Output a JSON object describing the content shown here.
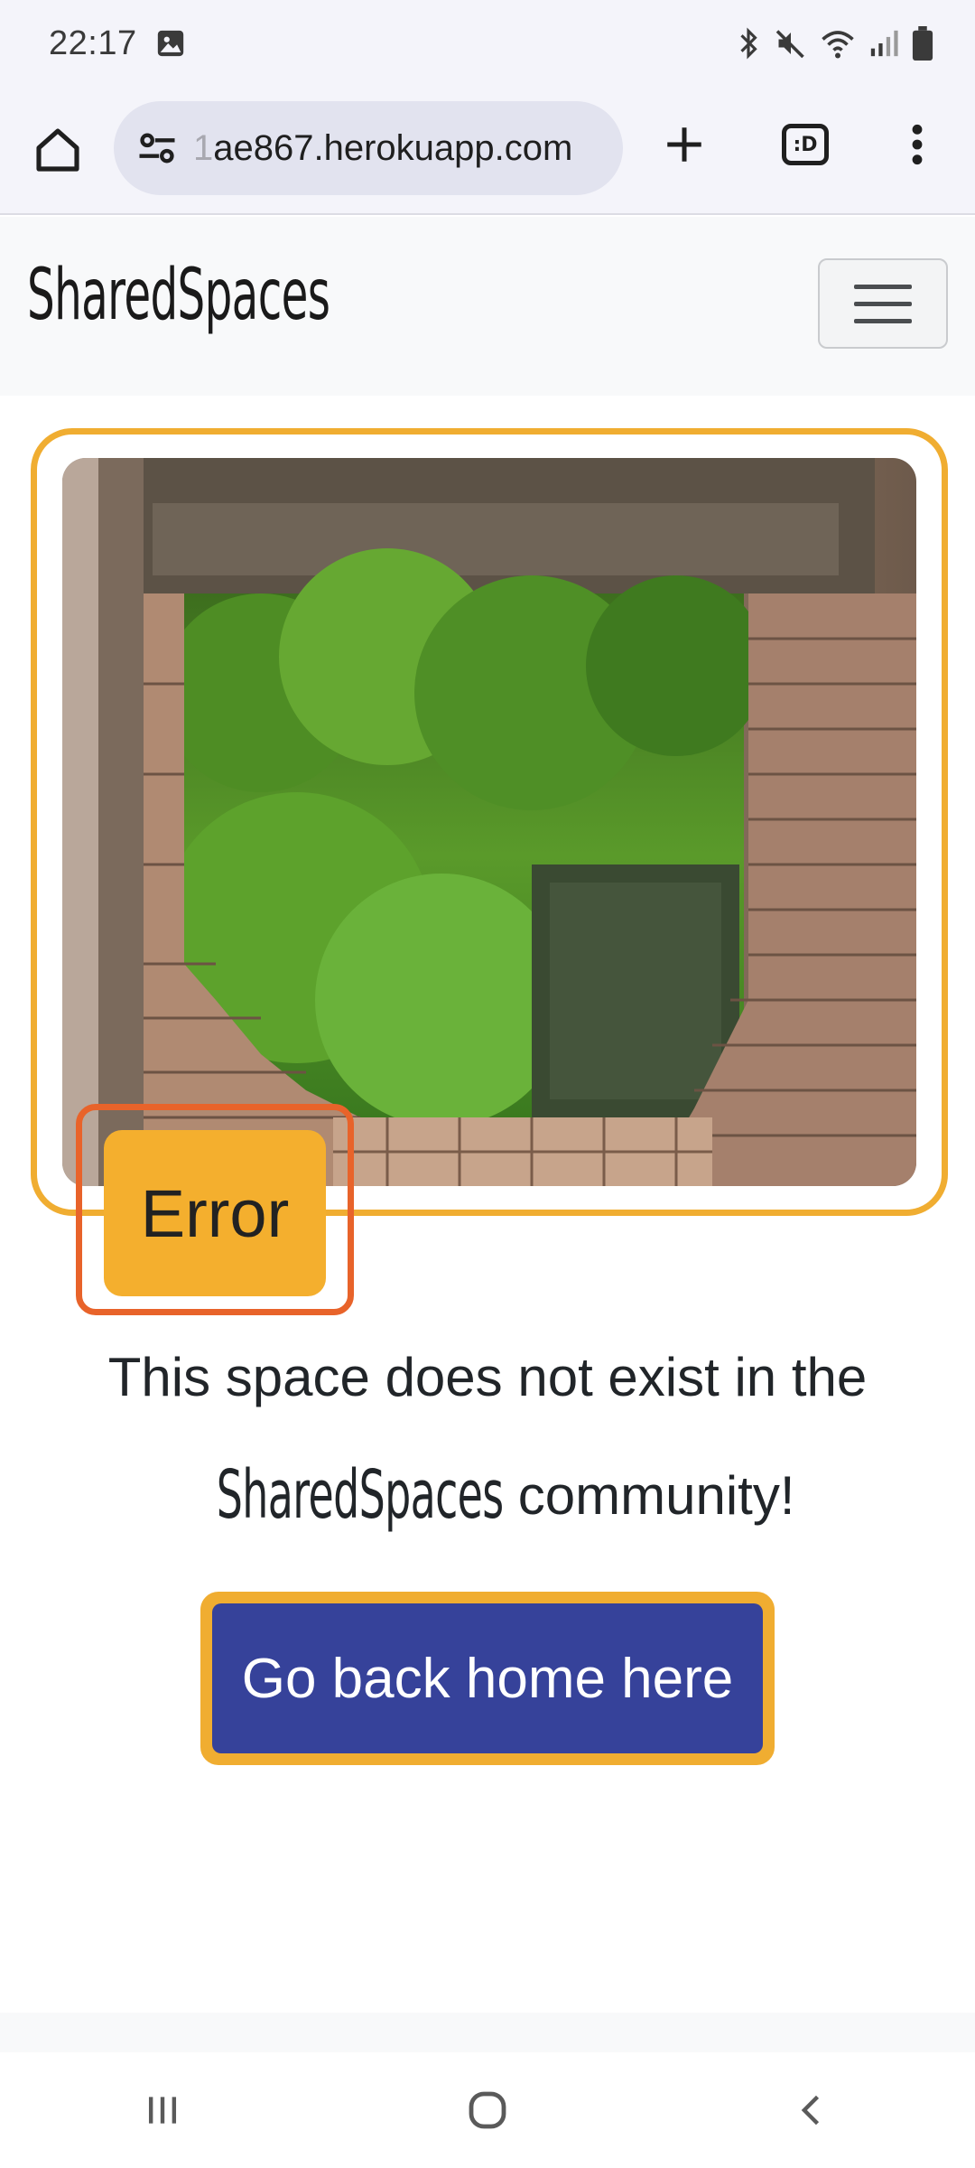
{
  "status_bar": {
    "time": "22:17",
    "icons": [
      "image-icon",
      "bluetooth-icon",
      "mute-icon",
      "wifi-icon",
      "signal-icon",
      "battery-icon"
    ]
  },
  "browser": {
    "url_fade": "1",
    "url": "ae867.herokuapp.com",
    "tab_label": ":D",
    "icons": [
      "home-icon",
      "site-settings-icon",
      "new-tab-plus-icon",
      "tab-switcher-icon",
      "overflow-menu-icon"
    ]
  },
  "navbar": {
    "brand": "SharedSpaces",
    "toggler_icon": "hamburger-icon"
  },
  "error": {
    "badge": "Error",
    "message_part1": "This space does not exist in the",
    "message_brand": "SharedSpaces",
    "message_part2": "community!",
    "button_label": "Go back home here"
  },
  "image": {
    "description_icon": "broken-brick-window-photo"
  },
  "system_nav": {
    "icons": [
      "recents-icon",
      "home-circle-icon",
      "back-icon"
    ]
  },
  "colors": {
    "accent_orange": "#f0ad31",
    "badge_border": "#e8632a",
    "button_blue": "#36429a"
  }
}
